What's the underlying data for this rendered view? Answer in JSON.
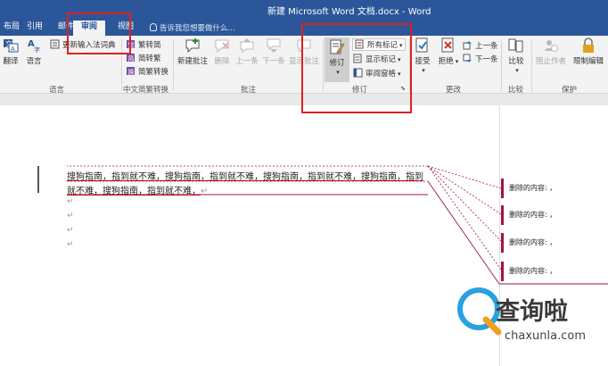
{
  "window": {
    "title": "新建 Microsoft Word 文档.docx - Word"
  },
  "tabs": [
    {
      "label": "布局"
    },
    {
      "label": "引用"
    },
    {
      "label": "邮件"
    },
    {
      "label": "审阅",
      "active": true
    },
    {
      "label": "视图"
    }
  ],
  "tell_me": "告诉我您想要做什么...",
  "ribbon": {
    "language": {
      "translate": "翻译",
      "language": "语言",
      "update_ime": "更新输入法词典",
      "group_label": "语言"
    },
    "chinese_conversion": {
      "to_traditional": "繁转简",
      "to_simplified": "简转繁",
      "convert": "简繁转换",
      "group_label": "中文简繁转换"
    },
    "comments": {
      "new": "新建批注",
      "delete": "删除",
      "previous": "上一条",
      "next": "下一条",
      "show": "显示批注",
      "group_label": "批注"
    },
    "tracking": {
      "track_changes": "修订",
      "all_markup": "所有标记",
      "show_markup": "显示标记",
      "reviewing_pane": "审阅窗格",
      "group_label": "修订"
    },
    "changes": {
      "accept": "接受",
      "reject": "拒绝",
      "previous": "上一条",
      "next": "下一条",
      "group_label": "更改"
    },
    "compare": {
      "compare": "比较",
      "group_label": "比较"
    },
    "protect": {
      "block_authors": "阻止作者",
      "restrict_editing": "限制编辑",
      "group_label": "保护"
    }
  },
  "document": {
    "line1": "搜狗指南，指到就不难，搜狗指南，指到就不难，搜狗指南，指到就不难，搜狗指南，指到",
    "line2": "就不难，搜狗指南，指到就不难，",
    "para_mark": "↵"
  },
  "balloons": [
    {
      "text": "删除的内容: ，"
    },
    {
      "text": "删除的内容: ，"
    },
    {
      "text": "删除的内容: ，"
    },
    {
      "text": "删除的内容: ，"
    }
  ],
  "watermark": {
    "brand": "查询啦",
    "url": "chaxunla.com"
  },
  "colors": {
    "accent": "#2b579a",
    "highlight": "#e02020",
    "revision": "#a0153e"
  }
}
